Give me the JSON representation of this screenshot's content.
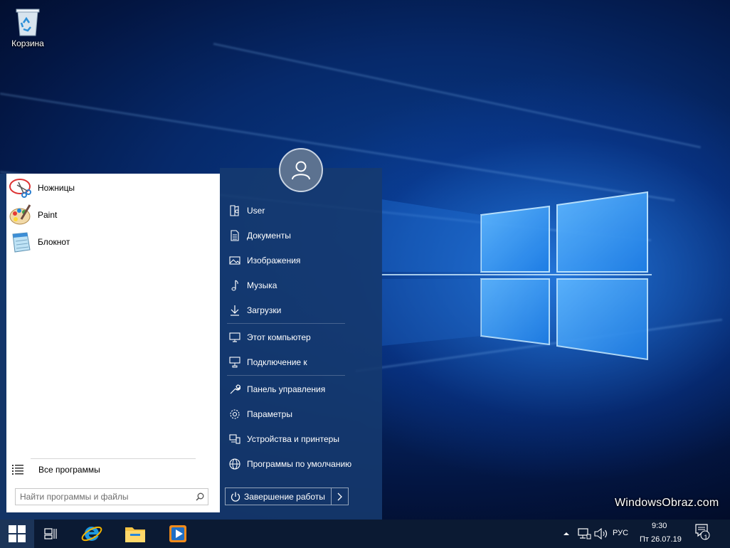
{
  "desktop": {
    "icons": [
      {
        "label": "Корзина",
        "icon": "recycle-bin-icon"
      }
    ]
  },
  "start_menu": {
    "programs": [
      {
        "label": "Ножницы",
        "icon": "snipping-tool-icon"
      },
      {
        "label": "Paint",
        "icon": "paint-icon"
      },
      {
        "label": "Блокнот",
        "icon": "notepad-icon"
      }
    ],
    "all_programs_label": "Все программы",
    "search_placeholder": "Найти программы и файлы",
    "right_items": [
      {
        "label": "User",
        "icon": "user-folder-icon"
      },
      {
        "label": "Документы",
        "icon": "documents-icon"
      },
      {
        "label": "Изображения",
        "icon": "pictures-icon"
      },
      {
        "label": "Музыка",
        "icon": "music-icon"
      },
      {
        "label": "Загрузки",
        "icon": "downloads-icon"
      },
      {
        "label": "Этот компьютер",
        "icon": "computer-icon"
      },
      {
        "label": "Подключение к",
        "icon": "network-connect-icon"
      },
      {
        "label": "Панель управления",
        "icon": "control-panel-icon"
      },
      {
        "label": "Параметры",
        "icon": "gear-icon"
      },
      {
        "label": "Устройства и принтеры",
        "icon": "printer-icon"
      },
      {
        "label": "Программы по умолчанию",
        "icon": "globe-icon"
      }
    ],
    "shutdown_label": "Завершение работы"
  },
  "taskbar": {
    "pinned": [
      "task-view-icon",
      "internet-explorer-icon",
      "file-explorer-icon",
      "media-player-icon"
    ],
    "language": "РУС",
    "time": "9:30",
    "date": "Пт 26.07.19",
    "notification_count": "1"
  },
  "watermark": "WindowsObraz.com",
  "colors": {
    "start_right_pane": "#163a70",
    "taskbar": "#0b1a33",
    "accent": "#1e88e5"
  }
}
